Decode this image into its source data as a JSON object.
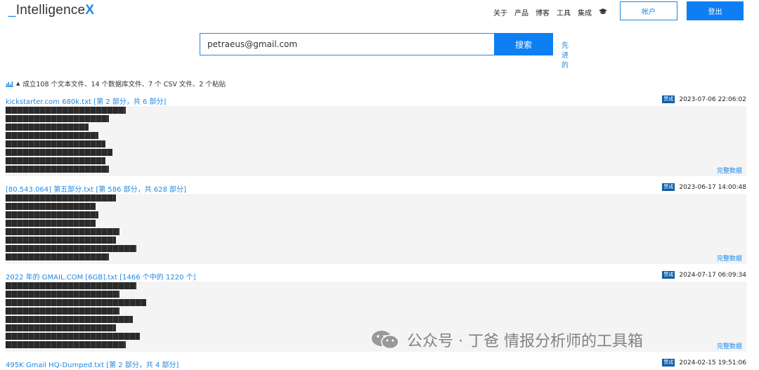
{
  "header": {
    "logo_prefix": "_",
    "logo_text": "Intelligence",
    "logo_x": "X",
    "nav": [
      "关于",
      "产品",
      "博客",
      "工具",
      "集成"
    ],
    "account_label": "帐户",
    "logout_label": "登出"
  },
  "search": {
    "value": "petraeus@gmail.com",
    "button_label": "搜索",
    "advanced_chars": [
      "先",
      "进",
      "的"
    ]
  },
  "summary": {
    "text": "成立108 个文本文件、14 个数据库文件、7 个 CSV 文件、2 个粘贴"
  },
  "results": [
    {
      "title": "kickstarter.com 680k.txt [第 2 部分，共 6 部分]",
      "badge": "赞成",
      "date": "2023-07-06 22:06:02",
      "full_data": "完整数据"
    },
    {
      "title": "[80.543.064] 第五部分.txt [第 586 部分，共 628 部分]",
      "badge": "赞成",
      "date": "2023-06-17 14:00:48",
      "full_data": "完整数据"
    },
    {
      "title": "2022 年的 GMAIL.COM [6GB].txt [1466 个中的 1220 个]",
      "badge": "赞成",
      "date": "2024-07-17 06:09:34",
      "full_data": "完整数据"
    },
    {
      "title": "495K Gmail HQ-Dumped.txt [第 2 部分，共 4 部分]",
      "badge": "赞成",
      "date": "2024-02-15 19:51:06",
      "full_data": ""
    }
  ],
  "watermark": {
    "text": "公众号 · 丁爸 情报分析师的工具箱"
  },
  "colors": {
    "accent": "#0d7ff2",
    "link": "#1e88e5",
    "badge": "#0d5ea8"
  }
}
